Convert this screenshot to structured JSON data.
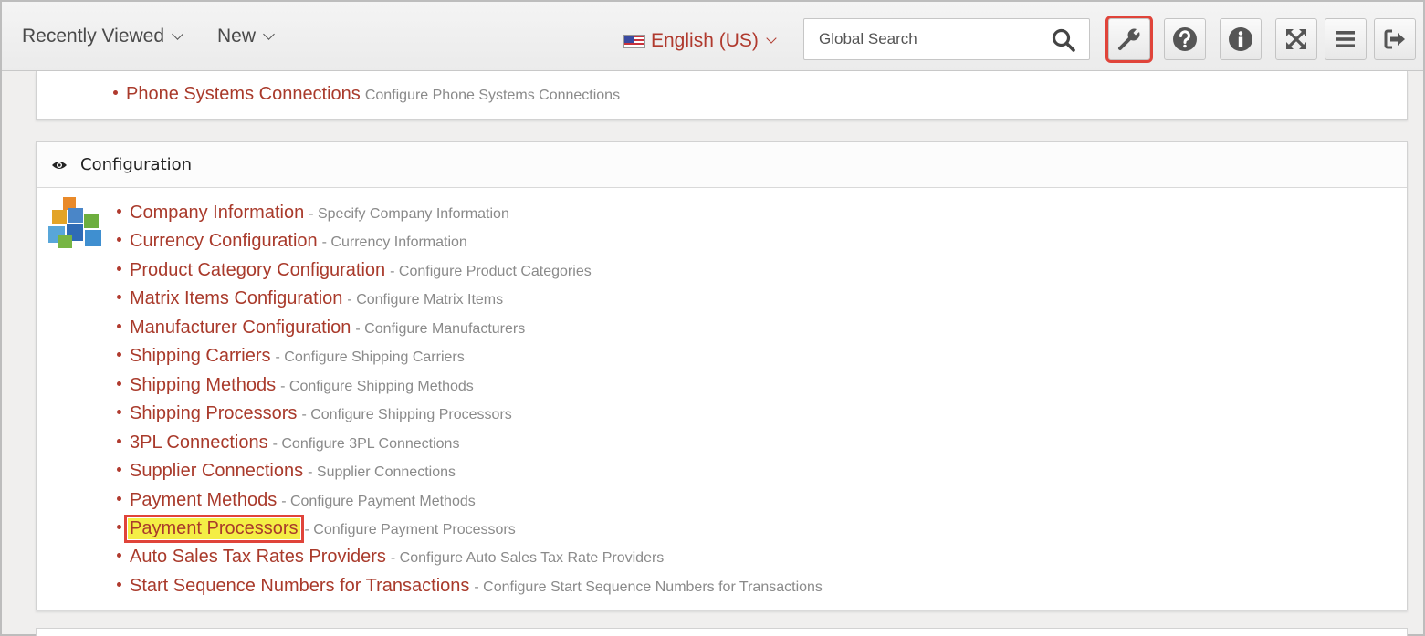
{
  "header": {
    "recently_viewed": "Recently Viewed",
    "new_menu": "New",
    "language": "English (US)",
    "search_placeholder": "Global Search"
  },
  "colors": {
    "link": "#a93a2b",
    "highlight": "#f4ee45",
    "callout": "#e0443a"
  },
  "toolbar_icons": [
    "setup-wrench-icon",
    "help-icon",
    "info-icon",
    "fullscreen-icon",
    "menu-icon",
    "logout-icon"
  ],
  "prev_section": {
    "item": {
      "label": "Phone Systems Connections",
      "desc": "Configure Phone Systems Connections"
    }
  },
  "config": {
    "title": "Configuration",
    "items": [
      {
        "label": "Company Information",
        "desc": "- Specify Company Information"
      },
      {
        "label": "Currency Configuration",
        "desc": "- Currency Information"
      },
      {
        "label": "Product Category Configuration",
        "desc": "- Configure Product Categories"
      },
      {
        "label": "Matrix Items Configuration",
        "desc": "- Configure Matrix Items"
      },
      {
        "label": "Manufacturer Configuration",
        "desc": "- Configure Manufacturers"
      },
      {
        "label": "Shipping Carriers",
        "desc": "- Configure Shipping Carriers"
      },
      {
        "label": "Shipping Methods",
        "desc": "- Configure Shipping Methods"
      },
      {
        "label": "Shipping Processors",
        "desc": "- Configure Shipping Processors"
      },
      {
        "label": "3PL Connections",
        "desc": "- Configure 3PL Connections"
      },
      {
        "label": "Supplier Connections",
        "desc": "- Supplier Connections"
      },
      {
        "label": "Payment Methods",
        "desc": "- Configure Payment Methods"
      },
      {
        "label": "Payment Processors",
        "desc": "- Configure Payment Processors"
      },
      {
        "label": "Auto Sales Tax Rates Providers",
        "desc": "- Configure Auto Sales Tax Rate Providers"
      },
      {
        "label": "Start Sequence Numbers for Transactions",
        "desc": "- Configure Start Sequence Numbers for Transactions"
      }
    ]
  }
}
